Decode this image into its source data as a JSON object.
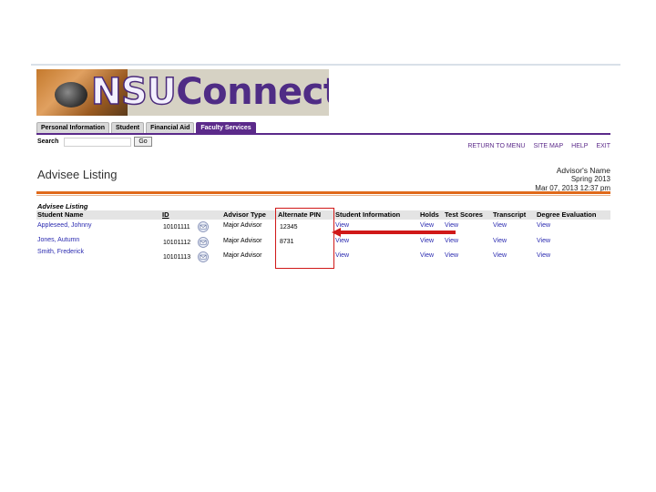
{
  "banner": {
    "logo_part1": "NSU",
    "logo_part2": "Connect"
  },
  "tabs": [
    {
      "label": "Personal Information",
      "active": false
    },
    {
      "label": "Student",
      "active": false
    },
    {
      "label": "Financial Aid",
      "active": false
    },
    {
      "label": "Faculty Services",
      "active": true
    }
  ],
  "search": {
    "label": "Search",
    "value": "",
    "go_label": "Go"
  },
  "top_links": [
    "RETURN TO MENU",
    "SITE MAP",
    "HELP",
    "EXIT"
  ],
  "page_title": "Advisee Listing",
  "advisor": {
    "name": "Advisor's Name",
    "term": "Spring 2013",
    "datetime": "Mar 07, 2013 12:37 pm"
  },
  "table": {
    "caption": "Advisee Listing",
    "headers": [
      "Student Name",
      "ID",
      "Advisor Type",
      "Alternate PIN",
      "Student Information",
      "Holds",
      "Test Scores",
      "Transcript",
      "Degree Evaluation"
    ],
    "rows": [
      {
        "name": "Appleseed, Johnny",
        "id": "10101111",
        "advisor_type": "Major Advisor",
        "pin": "12345",
        "student_info": "View",
        "holds": "View",
        "test_scores": "View",
        "transcript": "View",
        "degree_eval": "View"
      },
      {
        "name": "Jones, Autumn",
        "id": "10101112",
        "advisor_type": "Major Advisor",
        "pin": "8731",
        "student_info": "View",
        "holds": "View",
        "test_scores": "View",
        "transcript": "View",
        "degree_eval": "View"
      },
      {
        "name": "Smith, Frederick",
        "id": "10101113",
        "advisor_type": "Major Advisor",
        "pin": "",
        "student_info": "View",
        "holds": "View",
        "test_scores": "View",
        "transcript": "View",
        "degree_eval": "View"
      }
    ]
  },
  "icons": {
    "email": "envelope-icon"
  },
  "colors": {
    "brand_purple": "#5b2a8a",
    "accent_orange": "#e06a1a",
    "link_blue": "#2a2ab0",
    "highlight_red": "#d01818"
  }
}
